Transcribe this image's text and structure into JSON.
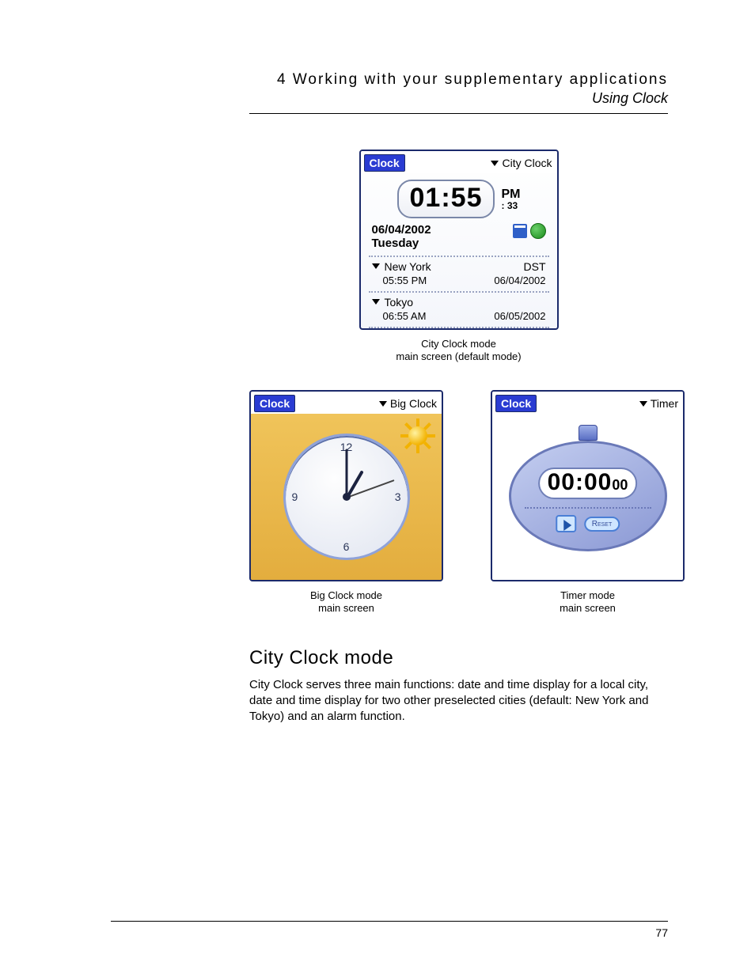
{
  "header": {
    "chapter": "4 Working with your supplementary applications",
    "section": "Using Clock"
  },
  "city_clock": {
    "app_label": "Clock",
    "mode_label": "City Clock",
    "time": "01:55",
    "ampm": "PM",
    "seconds": ": 33",
    "date": "06/04/2002",
    "weekday": "Tuesday",
    "cities": [
      {
        "name": "New York",
        "badge": "DST",
        "time": "05:55 PM",
        "date": "06/04/2002"
      },
      {
        "name": "Tokyo",
        "badge": "",
        "time": "06:55 AM",
        "date": "06/05/2002"
      }
    ],
    "caption_line1": "City Clock mode",
    "caption_line2": "main screen (default mode)"
  },
  "big_clock": {
    "app_label": "Clock",
    "mode_label": "Big Clock",
    "numerals": {
      "n12": "12",
      "n3": "3",
      "n6": "6",
      "n9": "9"
    },
    "caption_line1": "Big Clock mode",
    "caption_line2": "main screen"
  },
  "timer": {
    "app_label": "Clock",
    "mode_label": "Timer",
    "main": "00:00",
    "sub": "00",
    "reset_label": "Reset",
    "caption_line1": "Timer mode",
    "caption_line2": "main screen"
  },
  "body": {
    "heading": "City Clock mode",
    "paragraph": "City Clock serves three main functions: date and time display for a local city, date and time display for two other preselected cities (default: New York and Tokyo) and an alarm function."
  },
  "page_number": "77"
}
